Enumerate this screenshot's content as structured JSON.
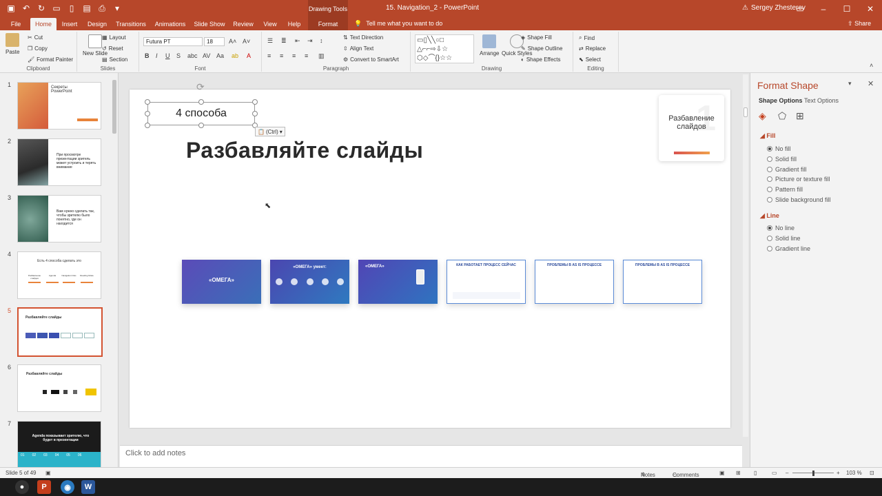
{
  "titlebar": {
    "contextual_tools": "Drawing Tools",
    "doc_title": "15. Navigation_2 - PowerPoint",
    "user": "Sergey Zhesterev"
  },
  "tabs": {
    "file": "File",
    "home": "Home",
    "insert": "Insert",
    "design": "Design",
    "transitions": "Transitions",
    "animations": "Animations",
    "slideshow": "Slide Show",
    "review": "Review",
    "view": "View",
    "help": "Help",
    "format": "Format"
  },
  "tellme": "Tell me what you want to do",
  "share": "Share",
  "ribbon": {
    "clipboard": {
      "paste": "Paste",
      "cut": "Cut",
      "copy": "Copy",
      "format_painter": "Format Painter",
      "label": "Clipboard"
    },
    "slides": {
      "new_slide": "New Slide",
      "layout": "Layout",
      "reset": "Reset",
      "section": "Section",
      "label": "Slides"
    },
    "font": {
      "font_name": "Futura PT",
      "font_size": "18",
      "label": "Font"
    },
    "paragraph": {
      "text_direction": "Text Direction",
      "align_text": "Align Text",
      "convert_smartart": "Convert to SmartArt",
      "label": "Paragraph"
    },
    "drawing": {
      "arrange": "Arrange",
      "quick_styles": "Quick Styles",
      "shape_fill": "Shape Fill",
      "shape_outline": "Shape Outline",
      "shape_effects": "Shape Effects",
      "label": "Drawing"
    },
    "editing": {
      "find": "Find",
      "replace": "Replace",
      "select": "Select",
      "label": "Editing"
    }
  },
  "thumbnails": [
    {
      "num": "1",
      "text": "Секреты PowerPoint"
    },
    {
      "num": "2",
      "text": "При просмотре презентации зритель может устроить и терять внимание"
    },
    {
      "num": "3",
      "text": "Вам нужно сделать так, чтобы зрителю было понятно, где он находится"
    },
    {
      "num": "4",
      "text": "Есть 4 способа сделать это"
    },
    {
      "num": "5",
      "text": "Разбавляйте слайды"
    },
    {
      "num": "6",
      "text": "Разбавляйте слайды"
    },
    {
      "num": "7",
      "text": "Agenda показывает зрителю, что будет в презентации"
    }
  ],
  "thumb4_items": [
    "Разбавление слайдов",
    "Agenda",
    "Navigation links",
    "Reading Mode"
  ],
  "thumb7_numbers": [
    "01",
    "02",
    "03",
    "04",
    "05",
    "06"
  ],
  "slide": {
    "selected_textbox": "4 способа",
    "title": "Разбавляйте слайды",
    "paste_tag": "(Ctrl)",
    "card_text": "Разбавление слайдов",
    "card_number": "1",
    "mini_slides": [
      {
        "title": "«ОМЕГА»"
      },
      {
        "title": "«ОМЕГА» умеет:"
      },
      {
        "title": "«ОМЕГА»"
      },
      {
        "title": "КАК РАБОТАЕТ ПРОЦЕСС СЕЙЧАС"
      },
      {
        "title": "ПРОБЛЕМЫ В AS IS ПРОЦЕССЕ"
      },
      {
        "title": "ПРОБЛЕМЫ В AS IS ПРОЦЕССЕ"
      }
    ]
  },
  "notes_placeholder": "Click to add notes",
  "format_pane": {
    "title": "Format Shape",
    "tab_shape": "Shape Options",
    "tab_text": "Text Options",
    "fill_label": "Fill",
    "fill_options": [
      "No fill",
      "Solid fill",
      "Gradient fill",
      "Picture or texture fill",
      "Pattern fill",
      "Slide background fill"
    ],
    "line_label": "Line",
    "line_options": [
      "No line",
      "Solid line",
      "Gradient line"
    ]
  },
  "status": {
    "slide_count": "Slide 5 of 49",
    "notes": "Notes",
    "comments": "Comments",
    "zoom": "103 %"
  },
  "colors": {
    "accent": "#b7472a",
    "selection": "#d35230"
  }
}
